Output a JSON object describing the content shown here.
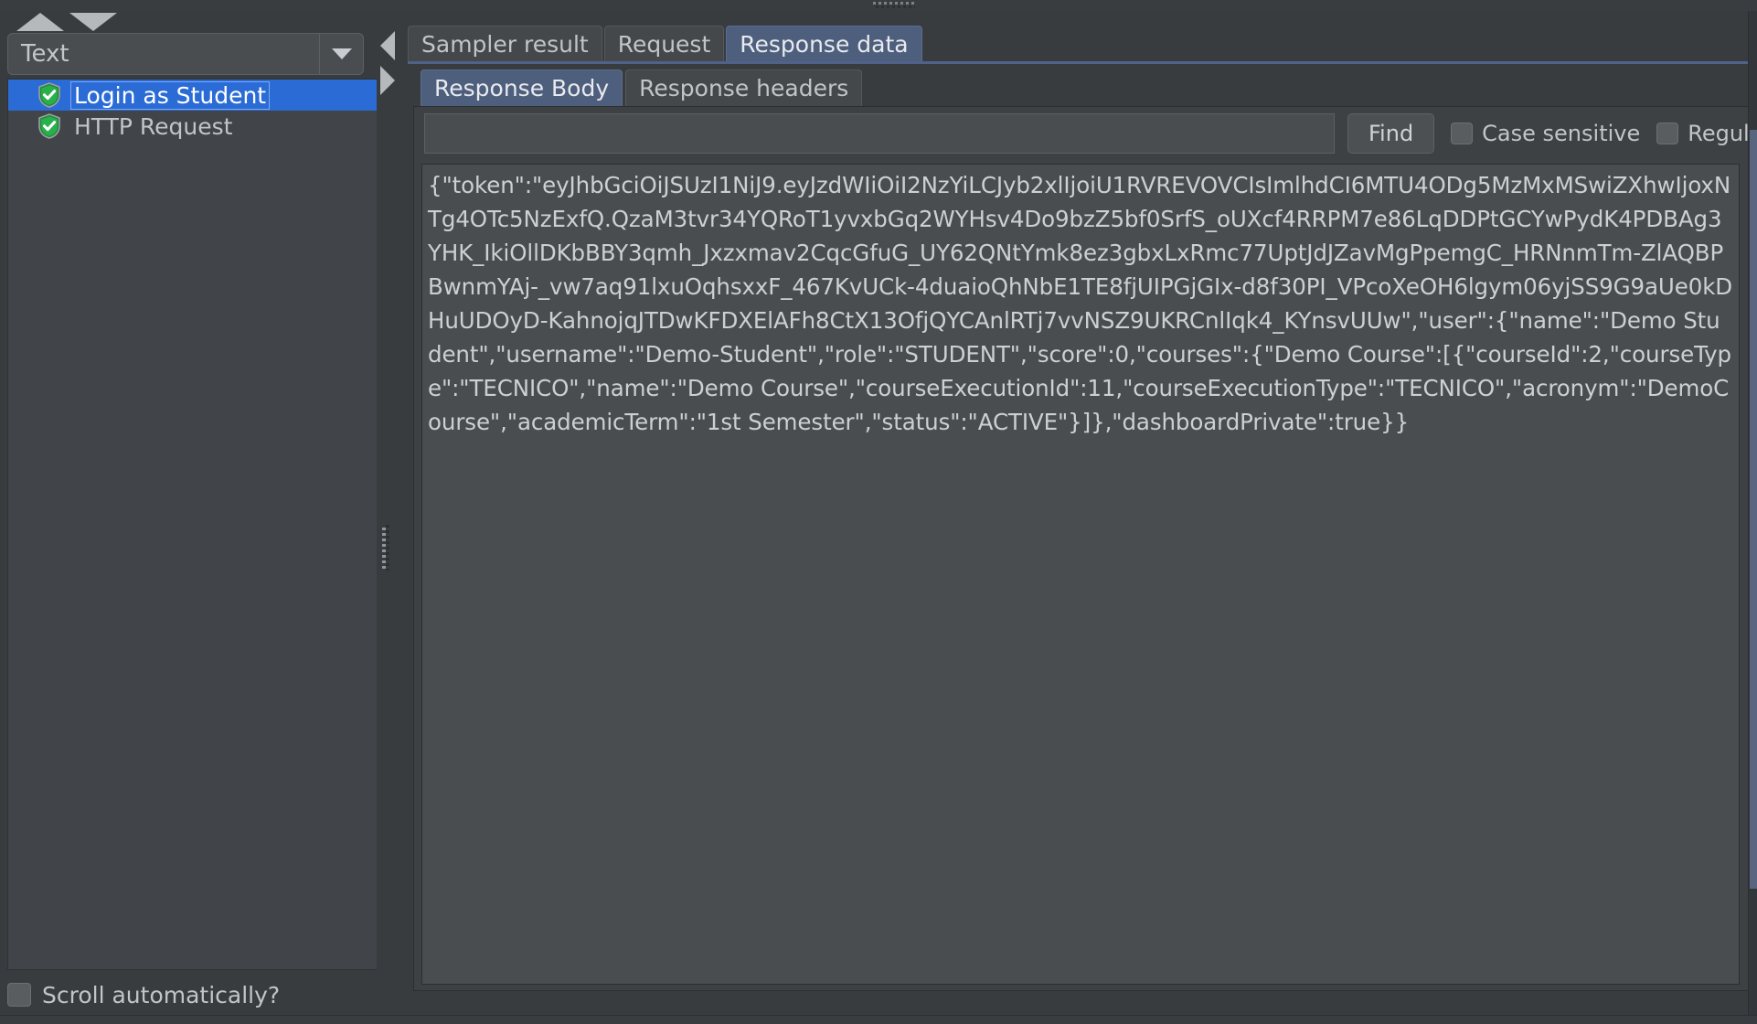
{
  "window": {
    "bg_color": "#393c3f",
    "accent_color": "#2a6bd6",
    "tab_active_color": "#4e5f7e"
  },
  "left_panel": {
    "render_combo": {
      "value": "Text",
      "arrow_icon": "chevron-down-icon"
    },
    "tree_items": [
      {
        "label": "Login as Student",
        "icon": "green-shield-check-icon",
        "selected": true
      },
      {
        "label": "HTTP Request",
        "icon": "green-shield-check-icon",
        "selected": false
      }
    ],
    "scroll_automatically": {
      "label": "Scroll automatically?",
      "checked": false
    },
    "sort_up_icon": "triangle-up-icon",
    "sort_down_icon": "triangle-down-icon"
  },
  "splitter": {
    "collapse_left_icon": "triangle-left-icon",
    "collapse_right_icon": "triangle-right-icon",
    "grip_icon": "splitter-grip-icon"
  },
  "right_panel": {
    "tabs": [
      {
        "label": "Sampler result",
        "active": false
      },
      {
        "label": "Request",
        "active": false
      },
      {
        "label": "Response data",
        "active": true
      }
    ],
    "subtabs": [
      {
        "label": "Response Body",
        "active": true
      },
      {
        "label": "Response headers",
        "active": false
      }
    ],
    "find_bar": {
      "search_value": "",
      "search_placeholder": "",
      "find_label": "Find",
      "case_sensitive_label": "Case sensitive",
      "case_sensitive_checked": false,
      "regular_exp_label": "Regular exp.",
      "regular_exp_checked": false
    },
    "response_body": "{\"token\":\"eyJhbGciOiJSUzI1NiJ9.eyJzdWIiOiI2NzYiLCJyb2xlIjoiU1RVREVOVCIsImlhdCI6MTU4ODg5MzMxMSwiZXhwIjoxNTg4OTc5NzExfQ.QzaM3tvr34YQRoT1yvxbGq2WYHsv4Do9bzZ5bf0SrfS_oUXcf4RRPM7e86LqDDPtGCYwPydK4PDBAg3YHK_IkiOllDKbBBY3qmh_Jxzxmav2CqcGfuG_UY62QNtYmk8ez3gbxLxRmc77UptJdJZavMgPpemgC_HRNnmTm-ZlAQBPBwnmYAj-_vw7aq91lxuOqhsxxF_467KvUCk-4duaioQhNbE1TE8fjUIPGjGIx-d8f30PI_VPcoXeOH6lgym06yjSS9G9aUe0kDHuUDOyD-KahnojqJTDwKFDXElAFh8CtX13OfjQYCAnlRTj7vvNSZ9UKRCnlIqk4_KYnsvUUw\",\"user\":{\"name\":\"Demo Student\",\"username\":\"Demo-Student\",\"role\":\"STUDENT\",\"score\":0,\"courses\":{\"Demo Course\":[{\"courseId\":2,\"courseType\":\"TECNICO\",\"name\":\"Demo Course\",\"courseExecutionId\":11,\"courseExecutionType\":\"TECNICO\",\"acronym\":\"DemoCourse\",\"academicTerm\":\"1st Semester\",\"status\":\"ACTIVE\"}]},\"dashboardPrivate\":true}}"
  }
}
